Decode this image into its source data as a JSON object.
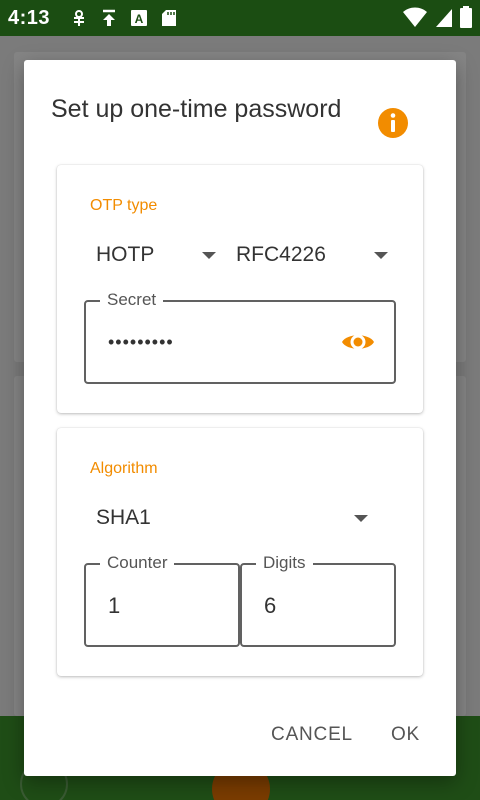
{
  "status_bar": {
    "time": "4:13",
    "left_icons": [
      "usb-debug-icon",
      "upload-icon",
      "a-icon",
      "sd-card-icon"
    ],
    "right_icons": [
      "wifi-icon",
      "signal-icon",
      "battery-icon"
    ]
  },
  "dialog": {
    "title": "Set up one-time password",
    "info_icon": "info-icon",
    "accent_color": "#f28c00",
    "otp_section": {
      "label": "OTP type",
      "type_value": "HOTP",
      "standard_value": "RFC4226",
      "secret": {
        "label": "Secret",
        "masked_value": "•••••••••",
        "visibility_icon": "eye-icon"
      }
    },
    "algorithm_section": {
      "label": "Algorithm",
      "algorithm_value": "SHA1",
      "counter": {
        "label": "Counter",
        "value": "1"
      },
      "digits": {
        "label": "Digits",
        "value": "6"
      }
    },
    "actions": {
      "cancel": "CANCEL",
      "ok": "OK"
    }
  }
}
